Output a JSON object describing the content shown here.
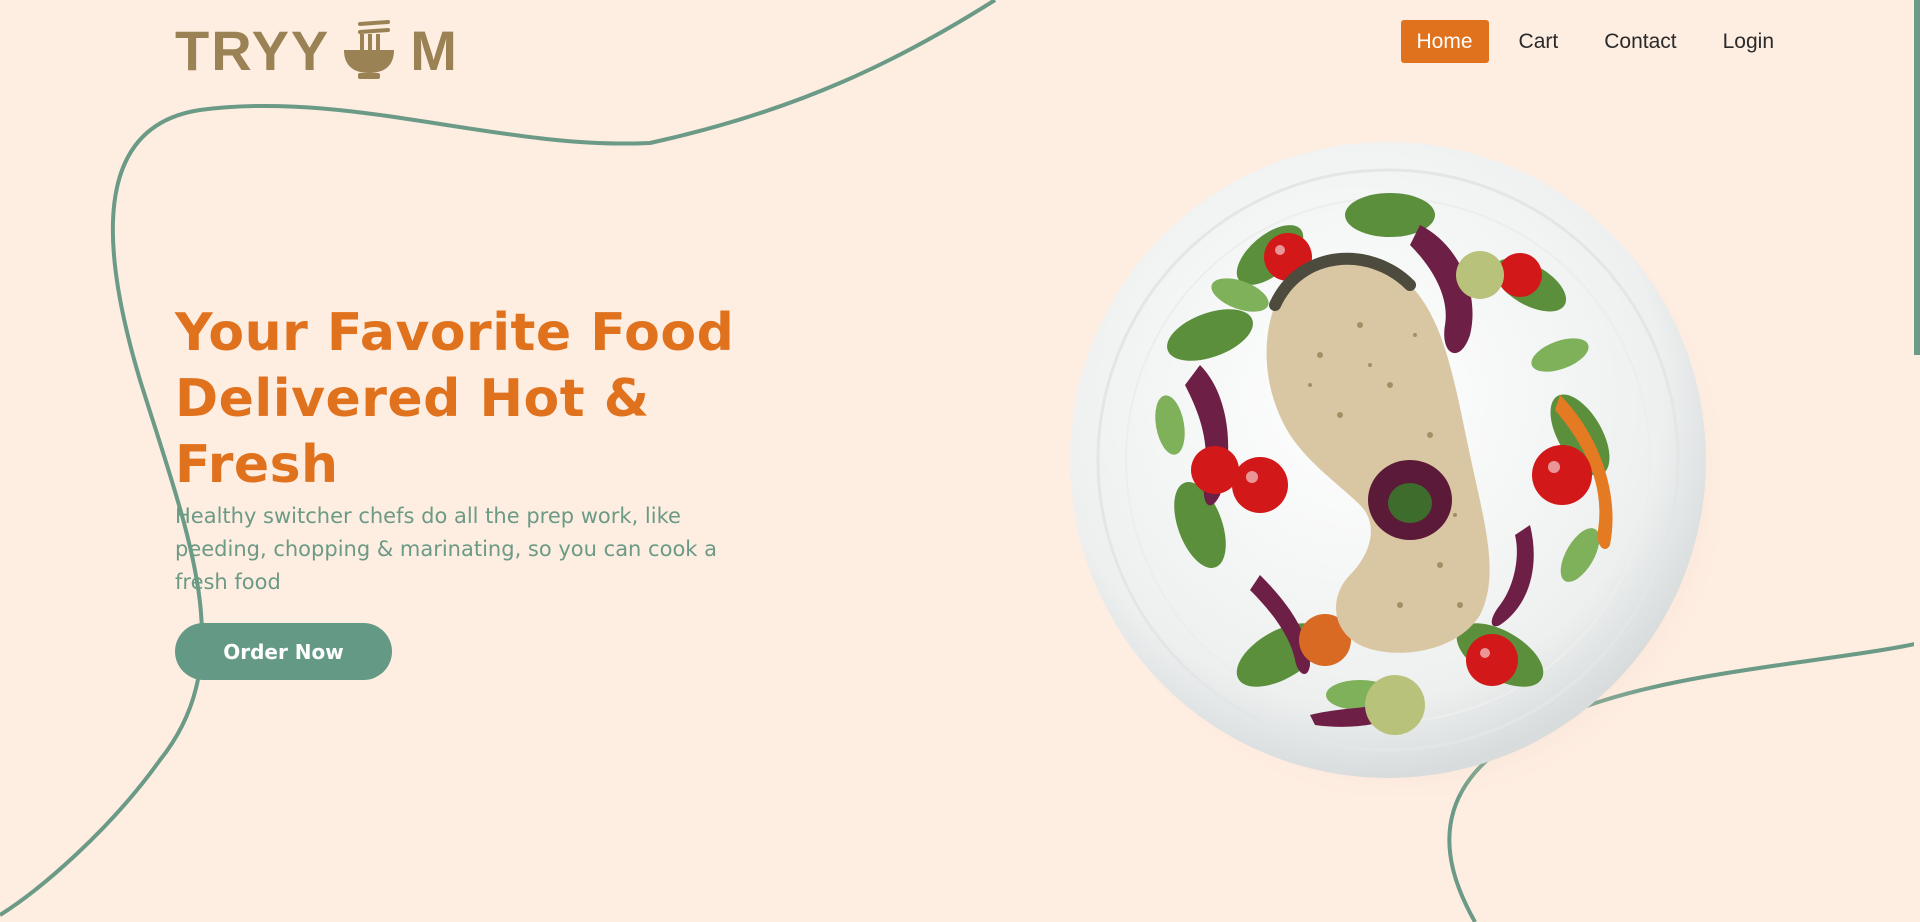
{
  "logo": {
    "text_left": "TRYY",
    "text_right": "M",
    "icon": "noodle-bowl-icon",
    "color": "#9b8255"
  },
  "nav": {
    "items": [
      {
        "label": "Home",
        "active": true
      },
      {
        "label": "Cart",
        "active": false
      },
      {
        "label": "Contact",
        "active": false
      },
      {
        "label": "Login",
        "active": false
      }
    ]
  },
  "hero": {
    "title": "Your Favorite Food Delivered Hot & Fresh",
    "subtitle": "Healthy switcher chefs do all the prep work, like peeding, chopping & marinating, so you can cook a fresh food",
    "cta_label": "Order Now"
  },
  "dish": {
    "icon": "salmon-salad-plate-image"
  },
  "colors": {
    "background": "#feede1",
    "accent_orange": "#e0711d",
    "accent_green": "#649a85",
    "logo_brown": "#9b8255"
  }
}
